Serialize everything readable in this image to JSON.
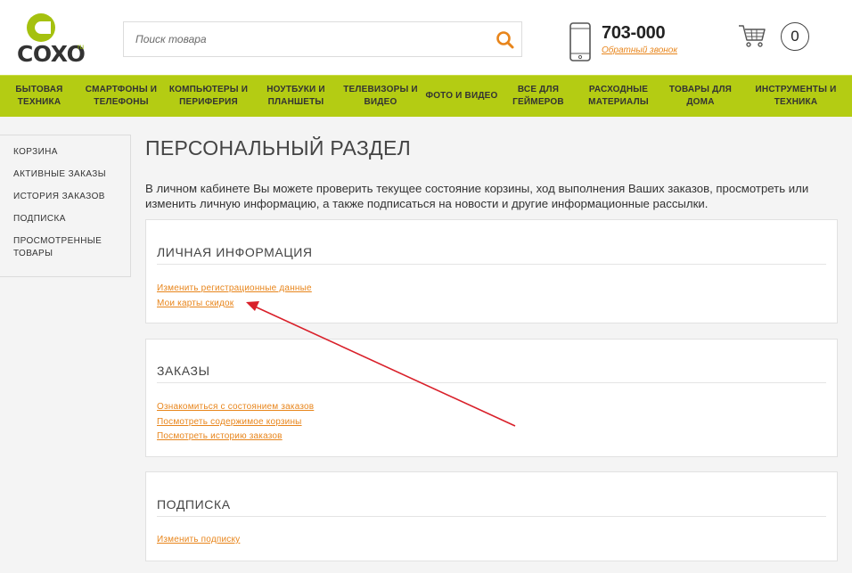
{
  "logo": {
    "text": "COXO",
    "suffix": "ru",
    "brand_color": "#a5c10f"
  },
  "search": {
    "placeholder": "Поиск товара"
  },
  "contact": {
    "phone": "703-000",
    "callback_label": "Обратный звонок"
  },
  "cart": {
    "count": "0"
  },
  "nav": {
    "items": [
      {
        "label": "Бытовая техника"
      },
      {
        "label": "Смартфоны и телефоны"
      },
      {
        "label": "Компьютеры и периферия"
      },
      {
        "label": "Ноутбуки и планшеты"
      },
      {
        "label": "Телевизоры и видео"
      },
      {
        "label": "Фото и видео"
      },
      {
        "label": "Все для геймеров"
      },
      {
        "label": "Расходные материалы"
      },
      {
        "label": "Товары для дома"
      },
      {
        "label": "Инструменты и техника"
      }
    ],
    "bg_color": "#b4cc13"
  },
  "sidebar": {
    "items": [
      {
        "label": "Корзина"
      },
      {
        "label": "Активные заказы"
      },
      {
        "label": "История заказов"
      },
      {
        "label": "Подписка"
      },
      {
        "label": "Просмотренные товары"
      }
    ]
  },
  "main": {
    "title": "Персональный раздел",
    "intro": "В личном кабинете Вы можете проверить текущее состояние корзины, ход выполнения Ваших заказов, просмотреть или изменить личную информацию, а также подписаться на новости и другие информационные рассылки.",
    "sections": [
      {
        "title": "Личная информация",
        "links": [
          "Изменить регистрационные данные",
          "Мои карты скидок"
        ]
      },
      {
        "title": "Заказы",
        "links": [
          "Ознакомиться с состоянием заказов",
          "Посмотреть содержимое корзины",
          "Посмотреть историю заказов"
        ]
      },
      {
        "title": "Подписка",
        "links": [
          "Изменить подписку"
        ]
      }
    ]
  },
  "colors": {
    "link": "#e8851b",
    "annotation_arrow": "#d9202a"
  }
}
